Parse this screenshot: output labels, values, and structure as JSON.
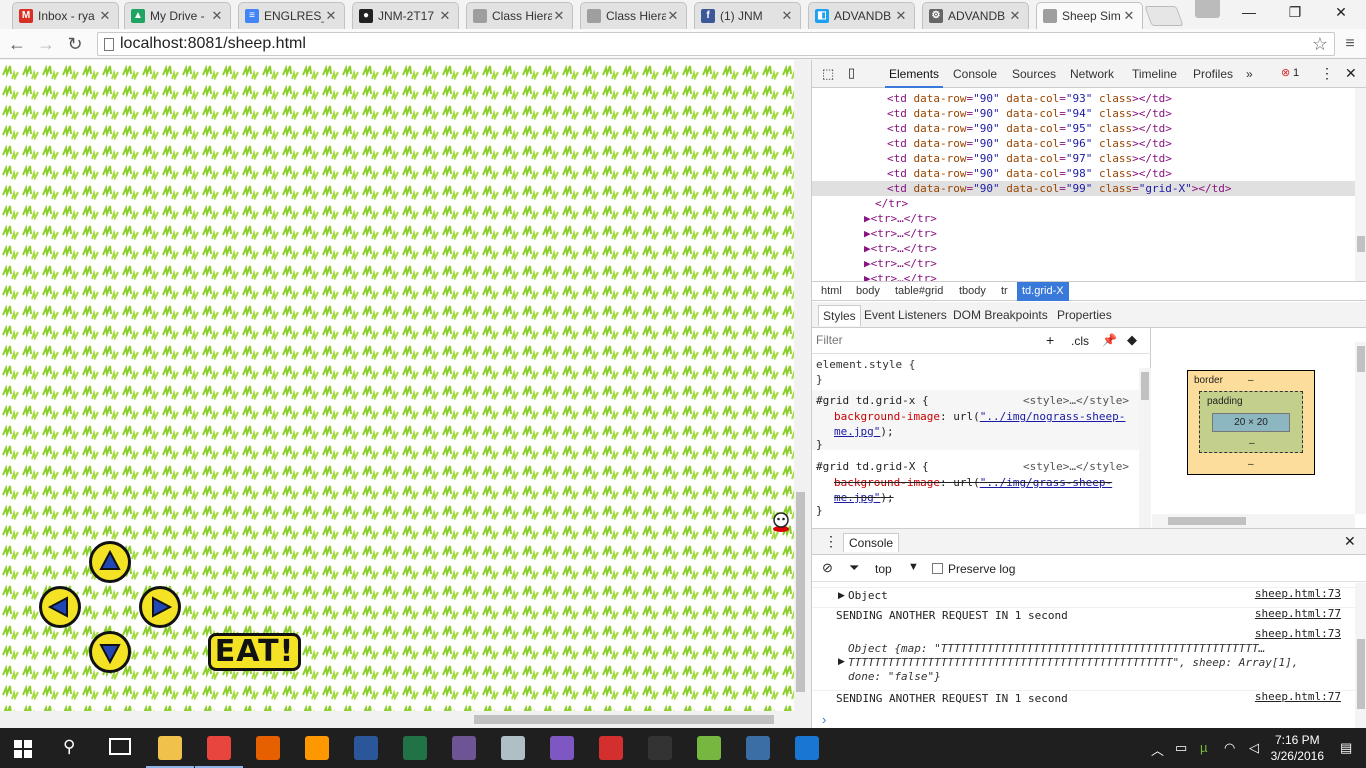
{
  "tabs": [
    {
      "title": "Inbox - rya",
      "icon": "gmail-icon",
      "color": "#d93025",
      "glyph": "M"
    },
    {
      "title": "My Drive -",
      "icon": "drive-icon",
      "color": "#1fa463",
      "glyph": "▲"
    },
    {
      "title": "ENGLRES_F",
      "icon": "docs-icon",
      "color": "#4285f4",
      "glyph": "≡"
    },
    {
      "title": "JNM-2T17",
      "icon": "github-icon",
      "color": "#222222",
      "glyph": "●"
    },
    {
      "title": "Class Hiera",
      "icon": "page-icon",
      "color": "#9e9e9e",
      "glyph": ""
    },
    {
      "title": "Class Hiera",
      "icon": "page-icon",
      "color": "#9e9e9e",
      "glyph": ""
    },
    {
      "title": "(1) JNM",
      "icon": "facebook-icon",
      "color": "#3b5998",
      "glyph": "f"
    },
    {
      "title": "ADVANDB",
      "icon": "app-icon",
      "color": "#1da1f2",
      "glyph": "◧"
    },
    {
      "title": "ADVANDB",
      "icon": "settings-icon",
      "color": "#666666",
      "glyph": "⚙"
    },
    {
      "title": "Sheep Sim",
      "icon": "page-icon",
      "color": "#9e9e9e",
      "glyph": ""
    }
  ],
  "window_controls": {
    "minimize": "—",
    "maximize": "❐",
    "close": "✕"
  },
  "address": {
    "url": "localhost:8081/sheep.html"
  },
  "game": {
    "eat_label": "EAT!"
  },
  "devtools": {
    "tabs": [
      "Elements",
      "Console",
      "Sources",
      "Network",
      "Timeline",
      "Profiles",
      "»"
    ],
    "error_count": "1",
    "dom_lines": [
      {
        "row": "90",
        "col": "93",
        "cls": ""
      },
      {
        "row": "90",
        "col": "94",
        "cls": ""
      },
      {
        "row": "90",
        "col": "95",
        "cls": ""
      },
      {
        "row": "90",
        "col": "96",
        "cls": ""
      },
      {
        "row": "90",
        "col": "97",
        "cls": ""
      },
      {
        "row": "90",
        "col": "98",
        "cls": ""
      },
      {
        "row": "90",
        "col": "99",
        "cls": "grid-X"
      }
    ],
    "dom_tail": [
      "</tr>",
      "<tr>…</tr>",
      "<tr>…</tr>",
      "<tr>…</tr>",
      "<tr>…</tr>",
      "<tr>…</tr>"
    ],
    "breadcrumbs": [
      "html",
      "body",
      "table#grid",
      "tbody",
      "tr",
      "td.grid-X"
    ],
    "subtabs": [
      "Styles",
      "Event Listeners",
      "DOM Breakpoints",
      "Properties"
    ],
    "filter_placeholder": "Filter",
    "cls_label": ".cls",
    "styles": {
      "element_style": "element.style {",
      "close": "}",
      "rule1_selector": "#grid td.grid-x {",
      "rule1_source": "<style>…</style>",
      "rule1_prop": "background-image",
      "rule1_url": "\"../img/nograss-sheep-me.jpg\"",
      "rule2_selector": "#grid td.grid-X {",
      "rule2_source": "<style>…</style>",
      "rule2_prop": "background-image",
      "rule2_url": "\"../img/grass-sheep-me.jpg\""
    },
    "boxmodel": {
      "border": "border",
      "padding": "padding",
      "content": "20 × 20",
      "dash": "–"
    },
    "console": {
      "title": "Console",
      "context": "top",
      "preserve_log": "Preserve log",
      "messages": [
        {
          "text": "Object",
          "src": "sheep.html:73"
        },
        {
          "text": "SENDING ANOTHER REQUEST IN 1 second",
          "src": "sheep.html:77"
        },
        {
          "src": "sheep.html:73",
          "obj_line1": "Object {map: \"TTTTTTTTTTTTTTTTTTTTTTTTTTTTTTTTTTTTTTTTTTTTTTTT…",
          "obj_line2": "TTTTTTTTTTTTTTTTTTTTTTTTTTTTTTTTTTTTTTTTTTTTTTTTT\", sheep: Array[1],",
          "obj_line3": "done: \"false\"}"
        },
        {
          "text": "SENDING ANOTHER REQUEST IN 1 second",
          "src": "sheep.html:77"
        }
      ],
      "prompt": "›"
    }
  },
  "taskbar": {
    "time": "7:16 PM",
    "date": "3/26/2016",
    "apps": [
      {
        "icon": "file-explorer-icon",
        "color": "#f0c24b"
      },
      {
        "icon": "chrome-icon",
        "color": "#e8453c"
      },
      {
        "icon": "firefox-icon",
        "color": "#e66000"
      },
      {
        "icon": "sublime-icon",
        "color": "#ff9800"
      },
      {
        "icon": "word-icon",
        "color": "#2b579a"
      },
      {
        "icon": "excel-icon",
        "color": "#217346"
      },
      {
        "icon": "github-desktop-icon",
        "color": "#6e5494"
      },
      {
        "icon": "app-icon",
        "color": "#b0bec5"
      },
      {
        "icon": "winrar-icon",
        "color": "#7e57c2"
      },
      {
        "icon": "acrobat-icon",
        "color": "#d32f2f"
      },
      {
        "icon": "terminal-icon",
        "color": "#333333"
      },
      {
        "icon": "utorrent-icon",
        "color": "#76b83f"
      },
      {
        "icon": "wireshark-icon",
        "color": "#3a6ea5"
      },
      {
        "icon": "steam-icon",
        "color": "#1976d2"
      }
    ]
  }
}
